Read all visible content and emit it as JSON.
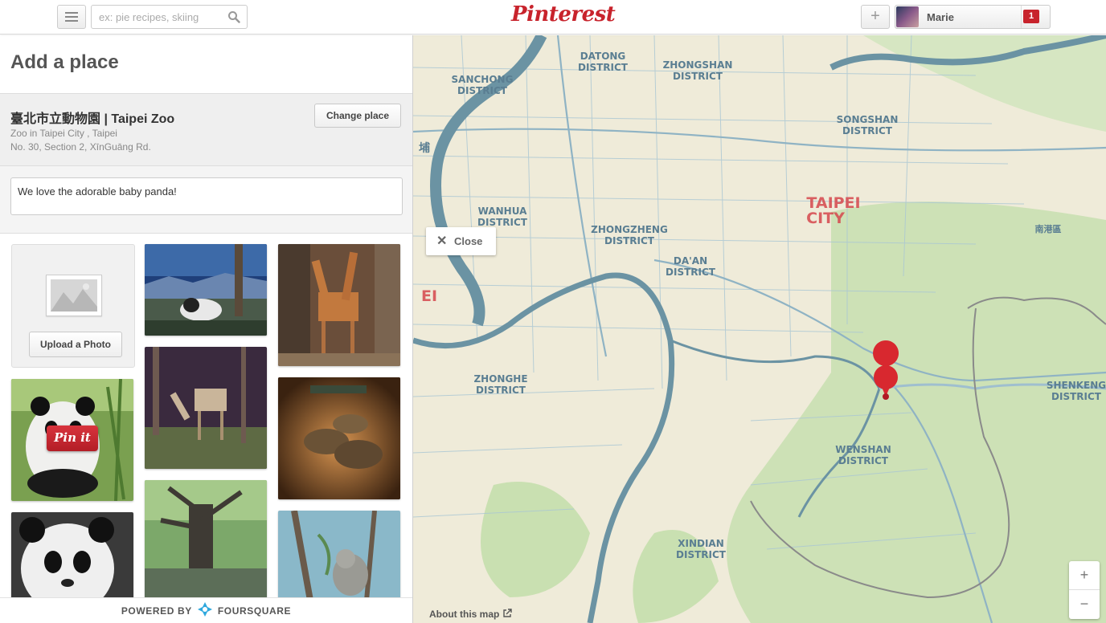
{
  "header": {
    "search_placeholder": "ex: pie recipes, skiing",
    "logo": "Pinterest",
    "add_label": "+",
    "user_name": "Marie",
    "notification_count": "1"
  },
  "panel": {
    "title": "Add a place",
    "place": {
      "name": "臺北市立動物園 | Taipei Zoo",
      "category": "Zoo in Taipei City , Taipei",
      "address": "No. 30, Section 2, XīnGuāng Rd."
    },
    "change_button": "Change place",
    "comment": "We love the adorable baby panda!",
    "upload_button": "Upload a Photo",
    "pinit_label": "Pin it",
    "powered_by": "POWERED BY",
    "provider": "FOURSQUARE"
  },
  "map": {
    "close_label": "Close",
    "about_label": "About this map",
    "zoom_in": "+",
    "zoom_out": "−",
    "labels": {
      "datong": [
        "DATONG",
        "DISTRICT"
      ],
      "zhongshan": [
        "ZHONGSHAN",
        "DISTRICT"
      ],
      "sanchong": [
        "SANCHONG",
        "DISTRICT"
      ],
      "songshan": [
        "SONGSHAN",
        "DISTRICT"
      ],
      "taipei": [
        "TAIPEI",
        "CITY"
      ],
      "wanhua": [
        "WANHUA",
        "DISTRICT"
      ],
      "zhongzheng": [
        "ZHONGZHENG",
        "DISTRICT"
      ],
      "daan": [
        "DA'AN",
        "DISTRICT"
      ],
      "zhonghe": [
        "ZHONGHE",
        "DISTRICT"
      ],
      "shenkeng": [
        "SHENKENG",
        "DISTRICT"
      ],
      "wenshan": [
        "WENSHAN",
        "DISTRICT"
      ],
      "xindian": [
        "XINDIAN",
        "DISTRICT"
      ],
      "nangang": "南港區",
      "pu": "埔",
      "ei": "EI"
    }
  },
  "colors": {
    "brand_red": "#c8232c",
    "map_land": "#efebd9",
    "map_park": "#c9e0b1",
    "map_water": "#6b93a3",
    "map_road": "#9fbfcf",
    "foursquare_blue": "#2fa8dd"
  }
}
